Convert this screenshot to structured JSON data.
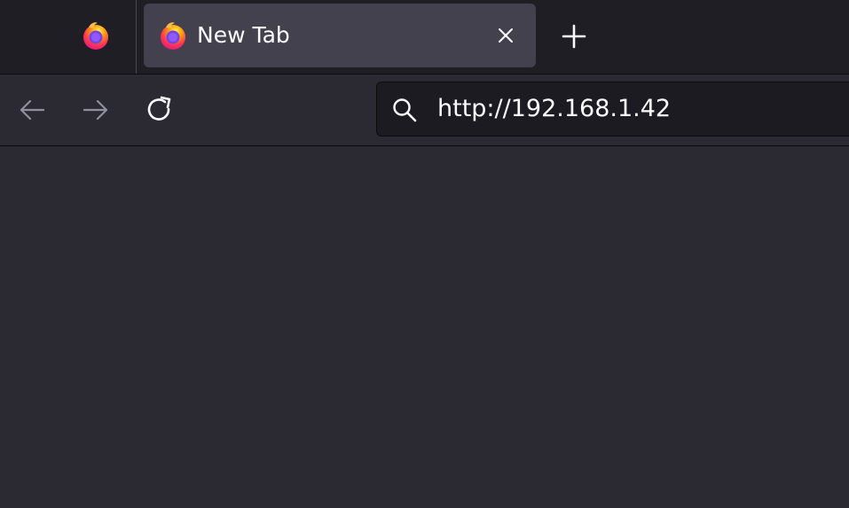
{
  "tabs": {
    "pinned": {
      "icon": "firefox-logo-icon"
    },
    "active": {
      "icon": "firefox-logo-icon",
      "title": "New Tab",
      "close_icon": "close-icon"
    },
    "new_tab_icon": "plus-icon"
  },
  "toolbar": {
    "back_icon": "arrow-left-icon",
    "forward_icon": "arrow-right-icon",
    "reload_icon": "reload-icon"
  },
  "urlbar": {
    "search_icon": "search-icon",
    "value": "http://192.168.1.42"
  },
  "colors": {
    "titlebar": "#1f1e25",
    "tab_active": "#42414d",
    "toolbar": "#2b2a33",
    "urlbar": "#1c1b22",
    "page": "#2b2a33",
    "text": "#fbfbfe"
  }
}
